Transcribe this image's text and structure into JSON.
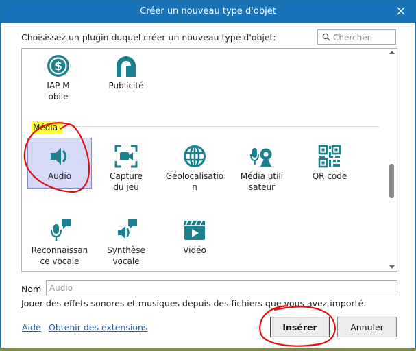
{
  "dialog": {
    "title": "Créer un nouveau type d'objet",
    "prompt": "Choisissez un plugin duquel créer un nouveau type d'objet:",
    "search_placeholder": "Chercher"
  },
  "tiles_top": [
    {
      "label": "IAP Mobile",
      "icon": "dollar-circle-icon"
    },
    {
      "label": "Publicité",
      "icon": "ad-icon"
    }
  ],
  "section": {
    "label": "Média"
  },
  "tiles_media": [
    {
      "label": "Audio",
      "icon": "speaker-icon"
    },
    {
      "label": "Capture du jeu",
      "icon": "screen-capture-icon"
    },
    {
      "label": "Géolocalisation",
      "icon": "globe-icon"
    },
    {
      "label": "Média utilisateur",
      "icon": "webcam-mic-icon"
    },
    {
      "label": "QR code",
      "icon": "qr-code-icon"
    },
    {
      "label": "Reconnaissance vocale",
      "icon": "speech-recognition-icon"
    },
    {
      "label": "Synthèse vocale",
      "icon": "speech-synthesis-icon"
    },
    {
      "label": "Vidéo",
      "icon": "video-icon"
    }
  ],
  "name_field": {
    "label": "Nom",
    "placeholder": "Audio"
  },
  "description": "Jouer des effets sonores et musiques depuis des fichiers que vous avez importé.",
  "links": {
    "help": "Aide",
    "extensions": "Obtenir des extensions"
  },
  "buttons": {
    "insert": "Insérer",
    "cancel": "Annuler"
  },
  "colors": {
    "titlebar": "#1873b8",
    "icon_teal": "#1b8190",
    "selection": "#d6daf7",
    "annotation_red": "#e01010",
    "highlight_yellow": "#ffff3a"
  }
}
